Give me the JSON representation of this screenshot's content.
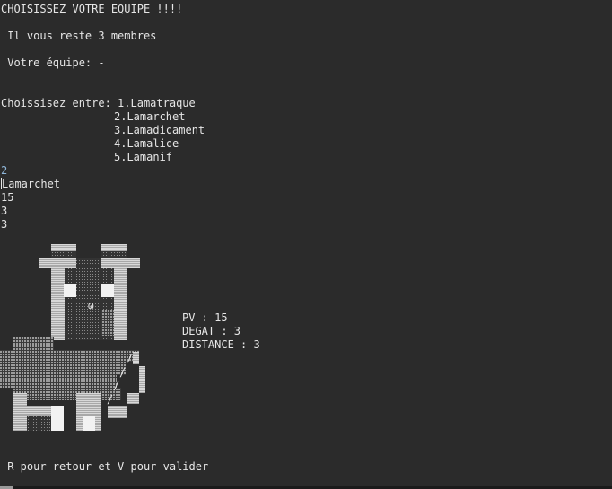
{
  "title": "CHOISISSEZ VOTRE EQUIPE !!!!",
  "remaining": " Il vous reste 3 membres",
  "team": " Votre équipe: -",
  "choose_prefix": "Choissisez entre: ",
  "options": [
    "1.Lamatraque",
    "2.Lamarchet",
    "3.Lamadicament",
    "4.Lamalice",
    "5.Lamanif"
  ],
  "user_input": "2",
  "selection": {
    "name": "Lamarchet",
    "line1": "15",
    "line2": "3",
    "line3": "3"
  },
  "sprite_glyph": "ω",
  "stats": {
    "pv": "PV : 15",
    "degat": "DEGAT : 3",
    "distance": "DISTANCE : 3"
  },
  "footer": " R pour retour et V pour valider"
}
